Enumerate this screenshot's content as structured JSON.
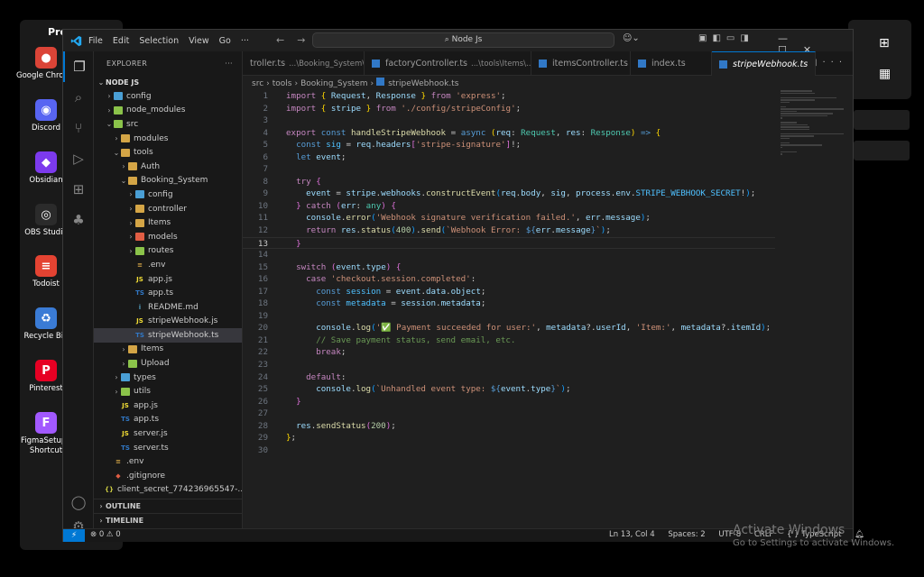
{
  "desktop": {
    "partial_title": "Pro",
    "icons": [
      {
        "label": "Google Chrome",
        "glyph": "●",
        "color": "#db4437",
        "icon": "chrome-icon"
      },
      {
        "label": "Discord",
        "glyph": "◉",
        "color": "#5865f2",
        "icon": "discord-icon"
      },
      {
        "label": "Obsidian",
        "glyph": "◆",
        "color": "#7c3aed",
        "icon": "obsidian-icon"
      },
      {
        "label": "OBS Studio",
        "glyph": "◎",
        "color": "#2b2b2b",
        "icon": "obs-icon"
      },
      {
        "label": "Todoist",
        "glyph": "≡",
        "color": "#e44332",
        "icon": "todoist-icon"
      },
      {
        "label": "Recycle Bin",
        "glyph": "♻",
        "color": "#3a7bd5",
        "icon": "recycle-bin-icon"
      },
      {
        "label": "Pinterest",
        "glyph": "P",
        "color": "#e60023",
        "icon": "pinterest-icon"
      },
      {
        "label": "FigmaSetup - Shortcut",
        "glyph": "F",
        "color": "#a259ff",
        "icon": "figma-icon"
      }
    ],
    "activation_line1": "Activate Windows",
    "activation_line2": "Go to Settings to activate Windows."
  },
  "titlebar": {
    "menu": [
      "File",
      "Edit",
      "Selection",
      "View",
      "Go",
      "···"
    ],
    "search": "Node Js"
  },
  "sidebar": {
    "header": "EXPLORER",
    "more": "···",
    "root": "NODE JS",
    "tree": [
      {
        "name": "config",
        "depth": 1,
        "type": "folder",
        "open": false,
        "color": "#4a9fd5"
      },
      {
        "name": "node_modules",
        "depth": 1,
        "type": "folder",
        "open": false,
        "color": "#8bc34a"
      },
      {
        "name": "src",
        "depth": 1,
        "type": "folder",
        "open": true,
        "color": "#8bc34a"
      },
      {
        "name": "modules",
        "depth": 2,
        "type": "folder",
        "open": false,
        "color": "#d4a546"
      },
      {
        "name": "tools",
        "depth": 2,
        "type": "folder",
        "open": true,
        "color": "#d4a546"
      },
      {
        "name": "Auth",
        "depth": 3,
        "type": "folder",
        "open": false,
        "color": "#d4a546"
      },
      {
        "name": "Booking_System",
        "depth": 3,
        "type": "folder",
        "open": true,
        "color": "#d4a546"
      },
      {
        "name": "config",
        "depth": 4,
        "type": "folder",
        "open": false,
        "color": "#4a9fd5"
      },
      {
        "name": "controller",
        "depth": 4,
        "type": "folder",
        "open": false,
        "color": "#d4a546"
      },
      {
        "name": "Items",
        "depth": 4,
        "type": "folder",
        "open": false,
        "color": "#d4a546"
      },
      {
        "name": "models",
        "depth": 4,
        "type": "folder",
        "open": false,
        "color": "#e05d44"
      },
      {
        "name": "routes",
        "depth": 4,
        "type": "folder",
        "open": false,
        "color": "#8bc34a"
      },
      {
        "name": ".env",
        "depth": 4,
        "type": "file",
        "glyph": "≡",
        "color": "#d4a546"
      },
      {
        "name": "app.js",
        "depth": 4,
        "type": "file",
        "glyph": "JS",
        "color": "#f1dd35"
      },
      {
        "name": "app.ts",
        "depth": 4,
        "type": "file",
        "glyph": "TS",
        "color": "#3178c6"
      },
      {
        "name": "README.md",
        "depth": 4,
        "type": "file",
        "glyph": "i",
        "color": "#519aba"
      },
      {
        "name": "stripeWebhook.js",
        "depth": 4,
        "type": "file",
        "glyph": "JS",
        "color": "#f1dd35"
      },
      {
        "name": "stripeWebhook.ts",
        "depth": 4,
        "type": "file",
        "glyph": "TS",
        "color": "#3178c6",
        "selected": true
      },
      {
        "name": "Items",
        "depth": 3,
        "type": "folder",
        "open": false,
        "color": "#d4a546"
      },
      {
        "name": "Upload",
        "depth": 3,
        "type": "folder",
        "open": false,
        "color": "#8bc34a"
      },
      {
        "name": "types",
        "depth": 2,
        "type": "folder",
        "open": false,
        "color": "#4a9fd5"
      },
      {
        "name": "utils",
        "depth": 2,
        "type": "folder",
        "open": false,
        "color": "#8bc34a"
      },
      {
        "name": "app.js",
        "depth": 2,
        "type": "file",
        "glyph": "JS",
        "color": "#f1dd35"
      },
      {
        "name": "app.ts",
        "depth": 2,
        "type": "file",
        "glyph": "TS",
        "color": "#3178c6"
      },
      {
        "name": "server.js",
        "depth": 2,
        "type": "file",
        "glyph": "JS",
        "color": "#f1dd35"
      },
      {
        "name": "server.ts",
        "depth": 2,
        "type": "file",
        "glyph": "TS",
        "color": "#3178c6"
      },
      {
        "name": ".env",
        "depth": 1,
        "type": "file",
        "glyph": "≡",
        "color": "#d4a546"
      },
      {
        "name": ".gitignore",
        "depth": 1,
        "type": "file",
        "glyph": "◆",
        "color": "#e05d44"
      },
      {
        "name": "client_secret_774236965547-...",
        "depth": 1,
        "type": "file",
        "glyph": "{}",
        "color": "#cbcb41"
      }
    ],
    "outline": "OUTLINE",
    "timeline": "TIMELINE"
  },
  "tabs": [
    {
      "name": "troller.ts",
      "sub": "...\\Booking_System\\..."
    },
    {
      "name": "factoryController.ts",
      "sub": "...\\tools\\Items\\..."
    },
    {
      "name": "itemsController.ts",
      "sub": ""
    },
    {
      "name": "index.ts",
      "sub": ""
    },
    {
      "name": "stripeWebhook.ts",
      "sub": "",
      "active": true
    }
  ],
  "breadcrumb": [
    "src",
    "tools",
    "Booking_System",
    "stripeWebhook.ts"
  ],
  "editor": {
    "current_line": 13,
    "lines": [
      "<span class=\"k\">import</span> <span class=\"b1\">{</span> <span class=\"v\">Request</span>, <span class=\"v\">Response</span> <span class=\"b1\">}</span> <span class=\"k\">from</span> <span class=\"s\">'express'</span>;",
      "<span class=\"k\">import</span> <span class=\"b1\">{</span> <span class=\"v\">stripe</span> <span class=\"b1\">}</span> <span class=\"k\">from</span> <span class=\"s\">'./config/stripeConfig'</span>;",
      "",
      "<span class=\"k\">export</span> <span class=\"kb\">const</span> <span class=\"f\">handleStripeWebhook</span> = <span class=\"kb\">async</span> <span class=\"b1\">(</span><span class=\"v\">req</span>: <span class=\"t\">Request</span>, <span class=\"v\">res</span>: <span class=\"t\">Response</span><span class=\"b1\">)</span> <span class=\"kb\">=&gt;</span> <span class=\"b1\">{</span>",
      "  <span class=\"kb\">const</span> <span class=\"cn\">sig</span> = <span class=\"v\">req</span>.<span class=\"v\">headers</span><span class=\"b2\">[</span><span class=\"s\">'stripe-signature'</span><span class=\"b2\">]</span>!;",
      "  <span class=\"kb\">let</span> <span class=\"v\">event</span>;",
      "",
      "  <span class=\"k\">try</span> <span class=\"b2\">{</span>",
      "    <span class=\"v\">event</span> = <span class=\"v\">stripe</span>.<span class=\"v\">webhooks</span>.<span class=\"f\">constructEvent</span><span class=\"b3\">(</span><span class=\"v\">req</span>.<span class=\"v\">body</span>, <span class=\"v\">sig</span>, <span class=\"v\">process</span>.<span class=\"v\">env</span>.<span class=\"cn\">STRIPE_WEBHOOK_SECRET</span>!<span class=\"b3\">)</span>;",
      "  <span class=\"b2\">}</span> <span class=\"k\">catch</span> <span class=\"b2\">(</span><span class=\"v\">err</span>: <span class=\"t\">any</span><span class=\"b2\">)</span> <span class=\"b2\">{</span>",
      "    <span class=\"v\">console</span>.<span class=\"f\">error</span><span class=\"b3\">(</span><span class=\"s\">'Webhook signature verification failed.'</span>, <span class=\"v\">err</span>.<span class=\"v\">message</span><span class=\"b3\">)</span>;",
      "    <span class=\"k\">return</span> <span class=\"v\">res</span>.<span class=\"f\">status</span><span class=\"b3\">(</span><span class=\"n\">400</span><span class=\"b3\">)</span>.<span class=\"f\">send</span><span class=\"b3\">(</span><span class=\"s\">`Webhook Error: </span><span class=\"kb\">${</span><span class=\"v\">err</span>.<span class=\"v\">message</span><span class=\"kb\">}</span><span class=\"s\">`</span><span class=\"b3\">)</span>;",
      "  <span class=\"b2\">}</span>",
      "",
      "  <span class=\"k\">switch</span> <span class=\"b2\">(</span><span class=\"v\">event</span>.<span class=\"v\">type</span><span class=\"b2\">)</span> <span class=\"b2\">{</span>",
      "    <span class=\"k\">case</span> <span class=\"s\">'checkout.session.completed'</span>:",
      "      <span class=\"kb\">const</span> <span class=\"cn\">session</span> = <span class=\"v\">event</span>.<span class=\"v\">data</span>.<span class=\"v\">object</span>;",
      "      <span class=\"kb\">const</span> <span class=\"cn\">metadata</span> = <span class=\"v\">session</span>.<span class=\"v\">metadata</span>;",
      "",
      "      <span class=\"v\">console</span>.<span class=\"f\">log</span><span class=\"b3\">(</span><span class=\"s\">'</span><span style=\"color:#3fb950\">✅</span><span class=\"s\"> Payment succeeded for user:'</span>, <span class=\"v\">metadata</span>?.<span class=\"v\">userId</span>, <span class=\"s\">'Item:'</span>, <span class=\"v\">metadata</span>?.<span class=\"v\">itemId</span><span class=\"b3\">)</span>;",
      "      <span class=\"c\">// Save payment status, send email, etc.</span>",
      "      <span class=\"k\">break</span>;",
      "",
      "    <span class=\"k\">default</span>:",
      "      <span class=\"v\">console</span>.<span class=\"f\">log</span><span class=\"b3\">(</span><span class=\"s\">`Unhandled event type: </span><span class=\"kb\">${</span><span class=\"v\">event</span>.<span class=\"v\">type</span><span class=\"kb\">}</span><span class=\"s\">`</span><span class=\"b3\">)</span>;",
      "  <span class=\"b2\">}</span>",
      "",
      "  <span class=\"v\">res</span>.<span class=\"f\">sendStatus</span><span class=\"b2\">(</span><span class=\"n\">200</span><span class=\"b2\">)</span>;",
      "<span class=\"b1\">}</span>;",
      ""
    ]
  },
  "status": {
    "remote": "⚡",
    "problems": "⊗ 0 ⚠ 0",
    "position": "Ln 13, Col 4",
    "spaces": "Spaces: 2",
    "encoding": "UTF-8",
    "eol": "CRLF",
    "language": "{ } TypeScript"
  }
}
